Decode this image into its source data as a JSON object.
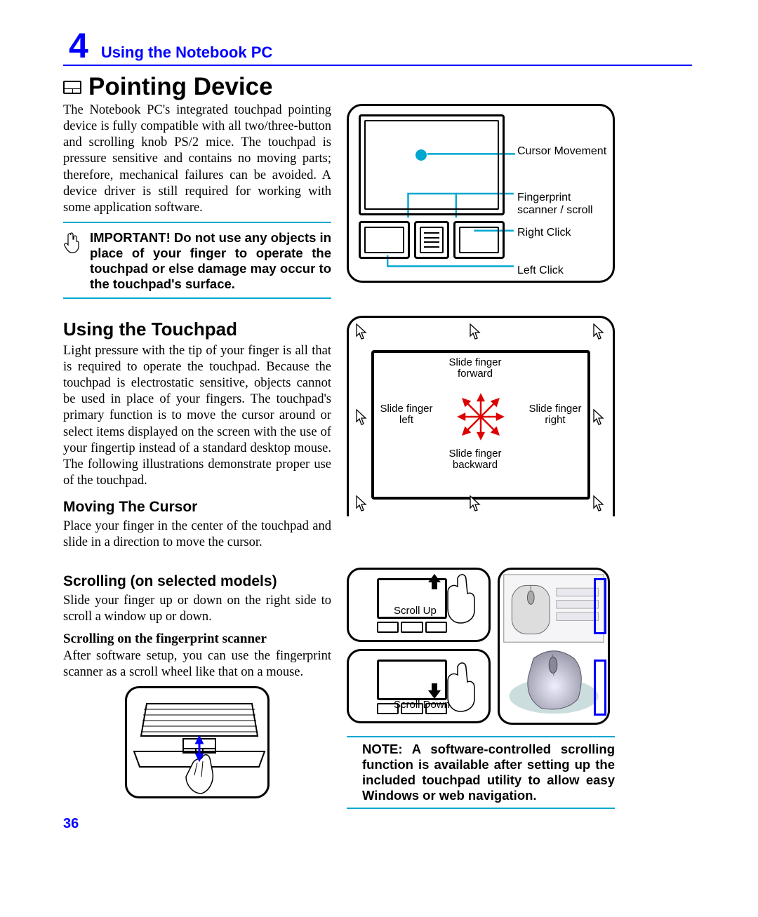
{
  "chapter_num": "4",
  "chapter_title": "Using the Notebook PC",
  "main_title": "Pointing Device",
  "intro_para": "The Notebook PC's integrated touchpad pointing device is fully compatible with all two/three-button and scrolling knob PS/2 mice. The touchpad is pressure sensitive and contains no moving parts; therefore, mechanical failures can be avoided. A device driver is still required for working with some application software.",
  "important_text": "IMPORTANT! Do not use any objects in place of your finger to operate the touchpad or else damage may occur to the touchpad's surface.",
  "section_touchpad": "Using the Touchpad",
  "touchpad_para": "Light pressure with the tip of your finger is all that is required to operate the touchpad. Because the touchpad is electrostatic sensitive, objects cannot be used in place of your fingers. The touchpad's primary function is to move the cursor around or select items displayed on the screen with the use of your fingertip instead of a standard desktop mouse. The following illustrations demonstrate proper use of the touchpad.",
  "section_moving": "Moving The Cursor",
  "moving_para": "Place your finger in the center of the touchpad and slide in a direction to move the cursor.",
  "section_scrolling": "Scrolling (on selected models)",
  "scrolling_para": "Slide your finger up or down on the right side to scroll a window up or down.",
  "scrolling_fp_heading": "Scrolling on the fingerprint scanner",
  "scrolling_fp_para": "After software setup, you can use the fingerprint scanner as a scroll wheel like that on a mouse.",
  "note_text": "NOTE: A software-controlled scrolling function is available after setting up the included touchpad utility to allow easy Windows or web navigation.",
  "page_number": "36",
  "diagram1": {
    "label_cursor": "Cursor Movement",
    "label_fp": "Fingerprint scanner / scroll",
    "label_right": "Right Click",
    "label_left": "Left Click"
  },
  "diagram2": {
    "forward": "Slide finger forward",
    "backward": "Slide finger backward",
    "left": "Slide finger left",
    "right": "Slide finger right"
  },
  "scroll": {
    "up": "Scroll Up",
    "down": "Scroll Down"
  }
}
